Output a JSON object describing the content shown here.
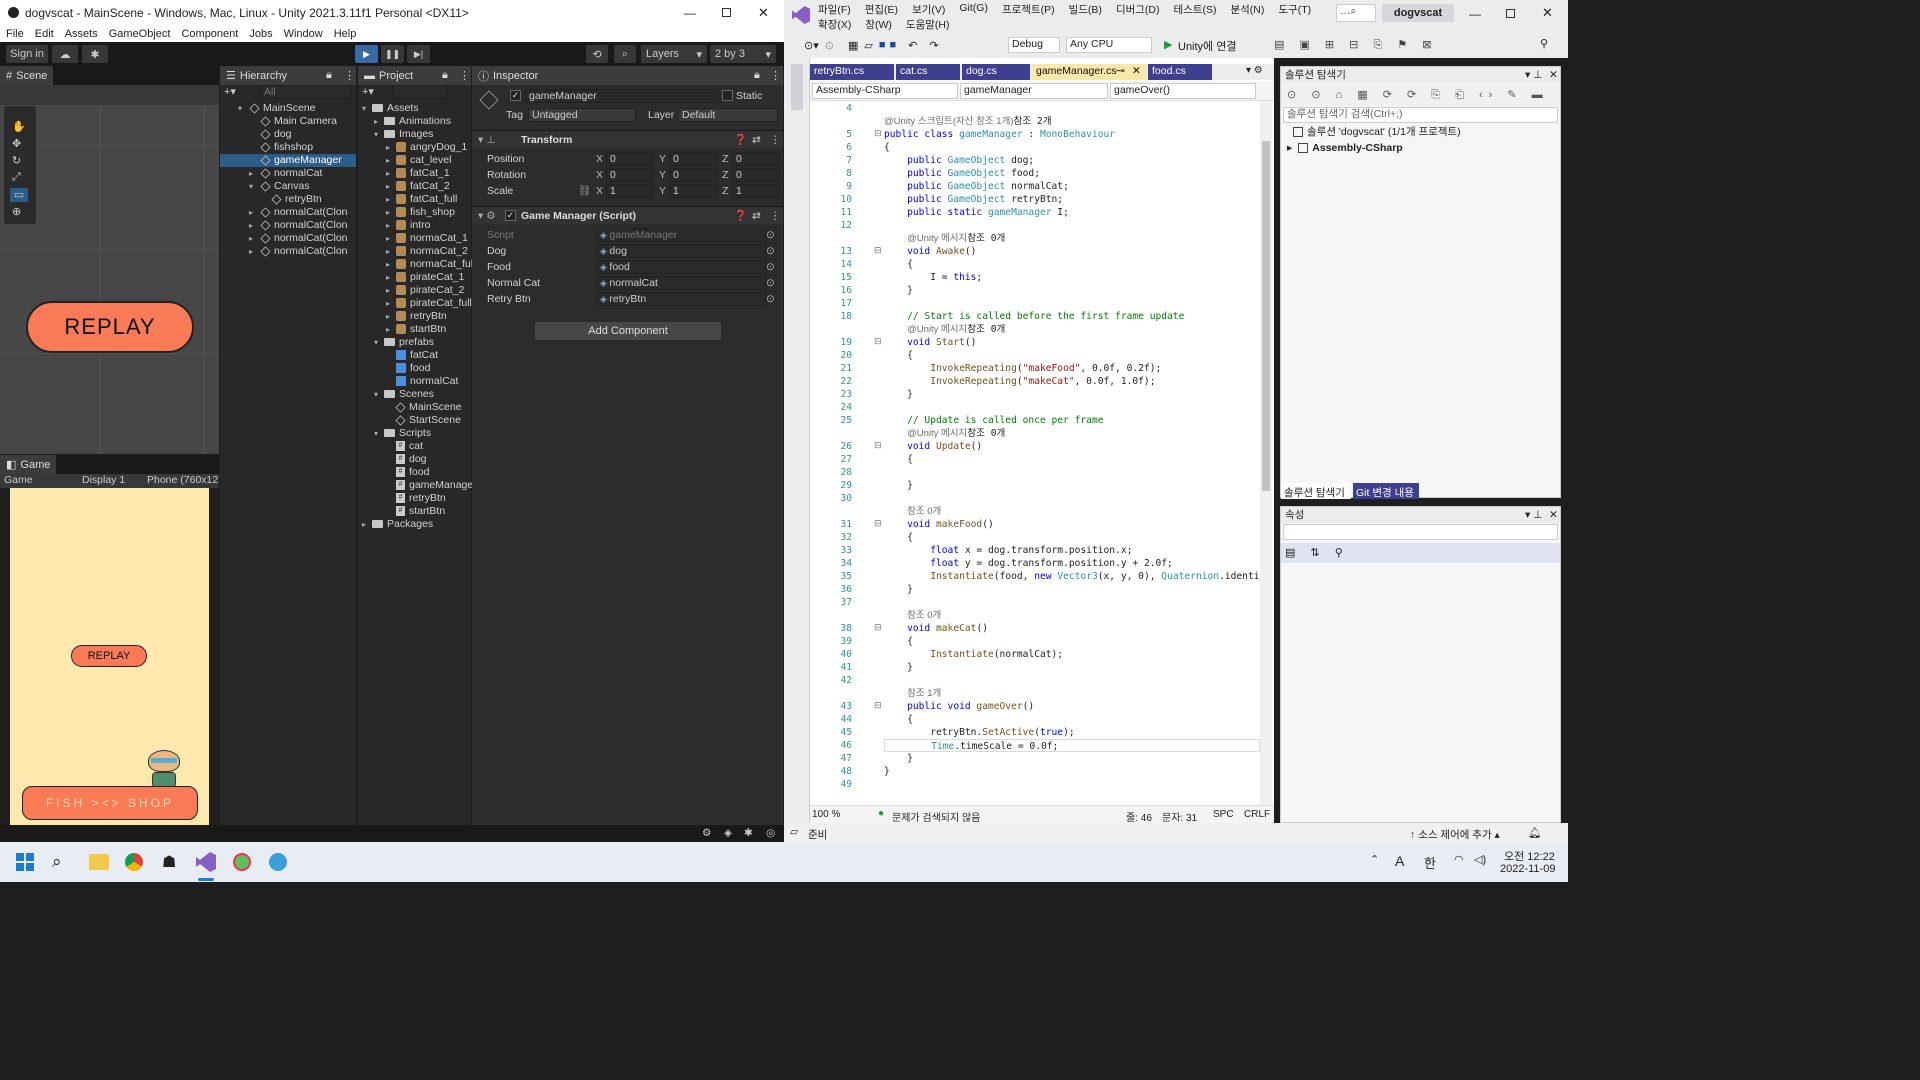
{
  "unity": {
    "title": "dogvscat - MainScene - Windows, Mac, Linux - Unity 2021.3.11f1 Personal <DX11>",
    "menu": [
      "File",
      "Edit",
      "Assets",
      "GameObject",
      "Component",
      "Jobs",
      "Window",
      "Help"
    ],
    "toolbar": {
      "sign_in": "Sign in",
      "layers": "Layers",
      "layout": "2 by 3"
    },
    "scene": {
      "tab": "Scene",
      "replay": "REPLAY"
    },
    "game": {
      "tab": "Game",
      "mode": "Game",
      "display": "Display 1",
      "resolution": "Phone (760x12",
      "replay": "REPLAY",
      "shop": "FISH  ><>  SHOP"
    },
    "hierarchy": {
      "tab": "Hierarchy",
      "search": "All",
      "items": [
        "MainScene",
        "Main Camera",
        "dog",
        "fishshop",
        "gameManager",
        "normalCat",
        "Canvas",
        "retryBtn",
        "normalCat(Clon",
        "normalCat(Clon",
        "normalCat(Clon",
        "normalCat(Clon"
      ]
    },
    "project": {
      "tab": "Project",
      "items": [
        "Assets",
        "Animations",
        "Images",
        "angryDog_1",
        "cat_level",
        "fatCat_1",
        "fatCat_2",
        "fatCat_full",
        "fish_shop",
        "intro",
        "normaCat_1",
        "normaCat_2",
        "normaCat_full",
        "pirateCat_1",
        "pirateCat_2",
        "pirateCat_full",
        "retryBtn",
        "startBtn",
        "prefabs",
        "fatCat",
        "food",
        "normalCat",
        "Scenes",
        "MainScene",
        "StartScene",
        "Scripts",
        "cat",
        "dog",
        "food",
        "gameManage",
        "retryBtn",
        "startBtn",
        "Packages"
      ]
    },
    "inspector": {
      "tab": "Inspector",
      "name": "gameManager",
      "static": "Static",
      "tag_label": "Tag",
      "tag": "Untagged",
      "layer_label": "Layer",
      "layer": "Default",
      "transform": "Transform",
      "position": "Position",
      "rotation": "Rotation",
      "scale": "Scale",
      "pos": [
        "0",
        "0",
        "0"
      ],
      "rot": [
        "0",
        "0",
        "0"
      ],
      "scl": [
        "1",
        "1",
        "1"
      ],
      "script_comp": "Game Manager (Script)",
      "fields": [
        {
          "label": "Script",
          "value": "gameManager"
        },
        {
          "label": "Dog",
          "value": "dog"
        },
        {
          "label": "Food",
          "value": "food"
        },
        {
          "label": "Normal Cat",
          "value": "normalCat"
        },
        {
          "label": "Retry Btn",
          "value": "retryBtn"
        }
      ],
      "add_component": "Add Component"
    }
  },
  "vs": {
    "menu1": [
      "파일(F)",
      "편집(E)",
      "보기(V)",
      "Git(G)",
      "프로젝트(P)",
      "빌드(B)",
      "디버그(D)",
      "테스트(S)",
      "분석(N)",
      "도구(T)"
    ],
    "menu2": [
      "확장(X)",
      "창(W)",
      "도움말(H)"
    ],
    "solution_name": "dogvscat",
    "config": "Debug",
    "platform": "Any CPU",
    "run": "Unity에 연결",
    "tabs": [
      "retryBtn.cs",
      "cat.cs",
      "dog.cs",
      "gameManager.cs",
      "food.cs"
    ],
    "nav": [
      "Assembly-CSharp",
      "gameManager",
      "gameOver()"
    ],
    "zoom": "100 %",
    "issues": "문제가 검색되지 않음",
    "line": "줄: 46",
    "col": "문자: 31",
    "spc": "SPC",
    "crlf": "CRLF",
    "status": "준비",
    "source_control": "소스 제어에 추가",
    "explorer": {
      "title": "솔루션 탐색기",
      "search": "솔루션 탐색기 검색(Ctrl+;)",
      "solution": "솔루션 'dogvscat' (1/1개 프로젝트)",
      "project": "Assembly-CSharp",
      "tab1": "솔루션 탐색기",
      "tab2": "Git 변경 내용"
    },
    "properties": {
      "title": "속성"
    },
    "code": [
      {
        "n": "4",
        "t": ""
      },
      {
        "n": "",
        "t": "lens:@Unity 스크립트(자산 참조 1개)|참조 2개"
      },
      {
        "n": "5",
        "t": "kw:public class |ty:gameManager| : |ty:MonoBehaviour"
      },
      {
        "n": "6",
        "t": "{"
      },
      {
        "n": "7",
        "t": "    |kw:public |ty:GameObject| dog;"
      },
      {
        "n": "8",
        "t": "    |kw:public |ty:GameObject| food;"
      },
      {
        "n": "9",
        "t": "    |kw:public |ty:GameObject| normalCat;"
      },
      {
        "n": "10",
        "t": "    |kw:public |ty:GameObject| retryBtn;"
      },
      {
        "n": "11",
        "t": "    |kw:public static |ty:gameManager| I;"
      },
      {
        "n": "12",
        "t": ""
      },
      {
        "n": "",
        "t": "    |lens:@Unity 메시지|참조 0개"
      },
      {
        "n": "13",
        "t": "    |kw:void |mt:Awake|()"
      },
      {
        "n": "14",
        "t": "    {"
      },
      {
        "n": "15",
        "t": "        I = |kw:this|;"
      },
      {
        "n": "16",
        "t": "    }"
      },
      {
        "n": "17",
        "t": ""
      },
      {
        "n": "18",
        "t": "    |cm:// Start is called before the first frame update"
      },
      {
        "n": "",
        "t": "    |lens:@Unity 메시지|참조 0개"
      },
      {
        "n": "19",
        "t": "    |kw:void |mt:Start|()"
      },
      {
        "n": "20",
        "t": "    {"
      },
      {
        "n": "21",
        "t": "        |mt:InvokeRepeating|(|st:\"makeFood\"|, 0.0f, 0.2f);"
      },
      {
        "n": "22",
        "t": "        |mt:InvokeRepeating|(|st:\"makeCat\"|, 0.0f, 1.0f);"
      },
      {
        "n": "23",
        "t": "    }"
      },
      {
        "n": "24",
        "t": ""
      },
      {
        "n": "25",
        "t": "    |cm:// Update is called once per frame"
      },
      {
        "n": "",
        "t": "    |lens:@Unity 메시지|참조 0개"
      },
      {
        "n": "26",
        "t": "    |kw:void |mt:Update|()"
      },
      {
        "n": "27",
        "t": "    {"
      },
      {
        "n": "28",
        "t": ""
      },
      {
        "n": "29",
        "t": "    }"
      },
      {
        "n": "30",
        "t": ""
      },
      {
        "n": "",
        "t": "    |lens:참조 0개"
      },
      {
        "n": "31",
        "t": "    |kw:void |mt:makeFood|()"
      },
      {
        "n": "32",
        "t": "    {"
      },
      {
        "n": "33",
        "t": "        |kw:float| x = dog.transform.position.x;"
      },
      {
        "n": "34",
        "t": "        |kw:float| y = dog.transform.position.y + 2.0f;"
      },
      {
        "n": "35",
        "t": "        |mt:Instantiate|(food, |kw:new |ty:Vector3|(x, y, 0), |ty:Quaternion|.identi"
      },
      {
        "n": "36",
        "t": "    }"
      },
      {
        "n": "37",
        "t": ""
      },
      {
        "n": "",
        "t": "    |lens:참조 0개"
      },
      {
        "n": "38",
        "t": "    |kw:void |mt:makeCat|()"
      },
      {
        "n": "39",
        "t": "    {"
      },
      {
        "n": "40",
        "t": "        |mt:Instantiate|(normalCat);"
      },
      {
        "n": "41",
        "t": "    }"
      },
      {
        "n": "42",
        "t": ""
      },
      {
        "n": "",
        "t": "    |lens:참조 1개"
      },
      {
        "n": "43",
        "t": "    |kw:public void |mt:gameOver|()"
      },
      {
        "n": "44",
        "t": "    {"
      },
      {
        "n": "45",
        "t": "        retryBtn.|mt:SetActive|(|kw:true|);"
      },
      {
        "n": "46",
        "t": "        |ty:Time|.timeScale = 0.0f;"
      },
      {
        "n": "47",
        "t": "    }"
      },
      {
        "n": "48",
        "t": "}"
      },
      {
        "n": "49",
        "t": ""
      }
    ]
  },
  "taskbar": {
    "time": "오전 12:22",
    "date": "2022-11-09",
    "ime1": "A",
    "ime2": "한"
  }
}
